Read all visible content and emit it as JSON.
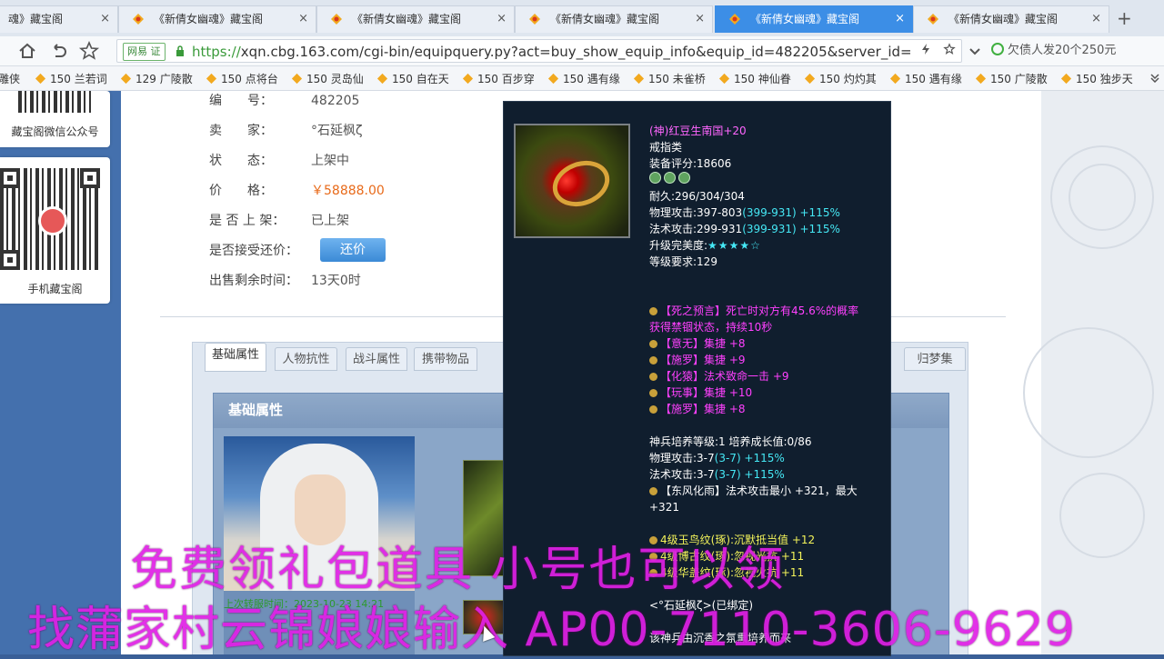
{
  "browser": {
    "tabs": [
      {
        "title": "魂》藏宝阁"
      },
      {
        "title": "《新倩女幽魂》藏宝阁"
      },
      {
        "title": "《新倩女幽魂》藏宝阁"
      },
      {
        "title": "《新倩女幽魂》藏宝阁"
      },
      {
        "title": "《新倩女幽魂》藏宝阁"
      },
      {
        "title": "《新倩女幽魂》藏宝阁"
      }
    ],
    "close_glyph": "×",
    "new_tab_glyph": "+",
    "netease_badge": "网易 证",
    "url_scheme": "https://",
    "url_rest": "xqn.cbg.163.com/cgi-bin/equipquery.py?act=buy_show_equip_info&equip_id=482205&server_id=",
    "search_text": "欠债人发20个250元",
    "bookmarks": [
      "雕侠",
      "150 兰若词",
      "129 广陵散",
      "150 点将台",
      "150 灵岛仙",
      "150 自在天",
      "150 百步穿",
      "150 遇有缘",
      "150 未雀桥",
      "150 神仙眷",
      "150 灼灼其",
      "150 遇有缘",
      "150 广陵散",
      "150 独步天"
    ]
  },
  "left_sidebar": {
    "wechat_label": "藏宝阁微信公众号",
    "mobile_label": "手机藏宝阁"
  },
  "item_info": {
    "id_label": "编　　号：",
    "id_value": "482205",
    "seller_label": "卖　　家：",
    "seller_value": "°石延枫ζ",
    "status_label": "状　　态：",
    "status_value": "上架中",
    "price_label": "价　　格：",
    "price_value": "￥58888.00",
    "listed_label": "是 否 上 架：",
    "listed_value": "已上架",
    "offer_label": "是否接受还价：",
    "offer_button": "还价",
    "time_left_label": "出售剩余时间：",
    "time_left_value": "13天0时"
  },
  "property_tabs": [
    "基础属性",
    "人物抗性",
    "战斗属性",
    "携带物品",
    "归梦集"
  ],
  "panel": {
    "title": "基础属性",
    "last_transfer": "上次转服时间：2023-10-23 14:21"
  },
  "tooltip": {
    "name": "(神)红豆生南国+20",
    "type": "戒指类",
    "score": "装备评分:18606",
    "durability": "耐久:296/304/304",
    "phys_attack_base": "物理攻击:397-803",
    "phys_attack_extra": "(399-931) +115%",
    "mag_attack_base": "法术攻击:299-931",
    "mag_attack_extra": "(399-931) +115%",
    "upgrade_label": "升级完美度:",
    "upgrade_stars": "★★★★☆",
    "level_req": "等级要求:129",
    "effects": [
      "【死之预言】死亡时对方有45.6%的概率",
      "获得禁锢状态，持续10秒",
      "【意无】集捷 +8",
      "【施罗】集捷 +9",
      "【化猿】法术致命一击 +9",
      "【玩事】集捷 +10",
      "【施罗】集捷 +8"
    ],
    "weapon_level": "神兵培养等级:1 培养成长值:0/86",
    "weapon_phys_base": "物理攻击:3-7",
    "weapon_phys_extra": "(3-7) +115%",
    "weapon_mag_base": "法术攻击:3-7",
    "weapon_mag_extra": "(3-7) +115%",
    "skill_line1": "【东风化雨】法术攻击最小 +321，最大",
    "skill_line2": "+321",
    "gems": [
      "4级玉鸟纹(琢):沉默抵当值 +12",
      "4级博古纹(琢):忽视光抗 +11",
      "4级华盖纹(琢):忽视火抗 +11"
    ],
    "bound": "<°石延枫ζ>(已绑定)",
    "footer": "该神兵由沉香之氛熏培养而来"
  },
  "overlay": {
    "line1": "免费领礼包道具 小号也可以领",
    "line2": "找蒲家村云锦娘娘输入 AP00-7110-3606-9629"
  },
  "colors": {
    "page_bg": "#4470ad",
    "active_tab": "#3c8ee6",
    "price": "#e86a1a",
    "tooltip_bg": "#101e2e",
    "item_name": "#ff66ff",
    "overlay": "#e020e6"
  }
}
